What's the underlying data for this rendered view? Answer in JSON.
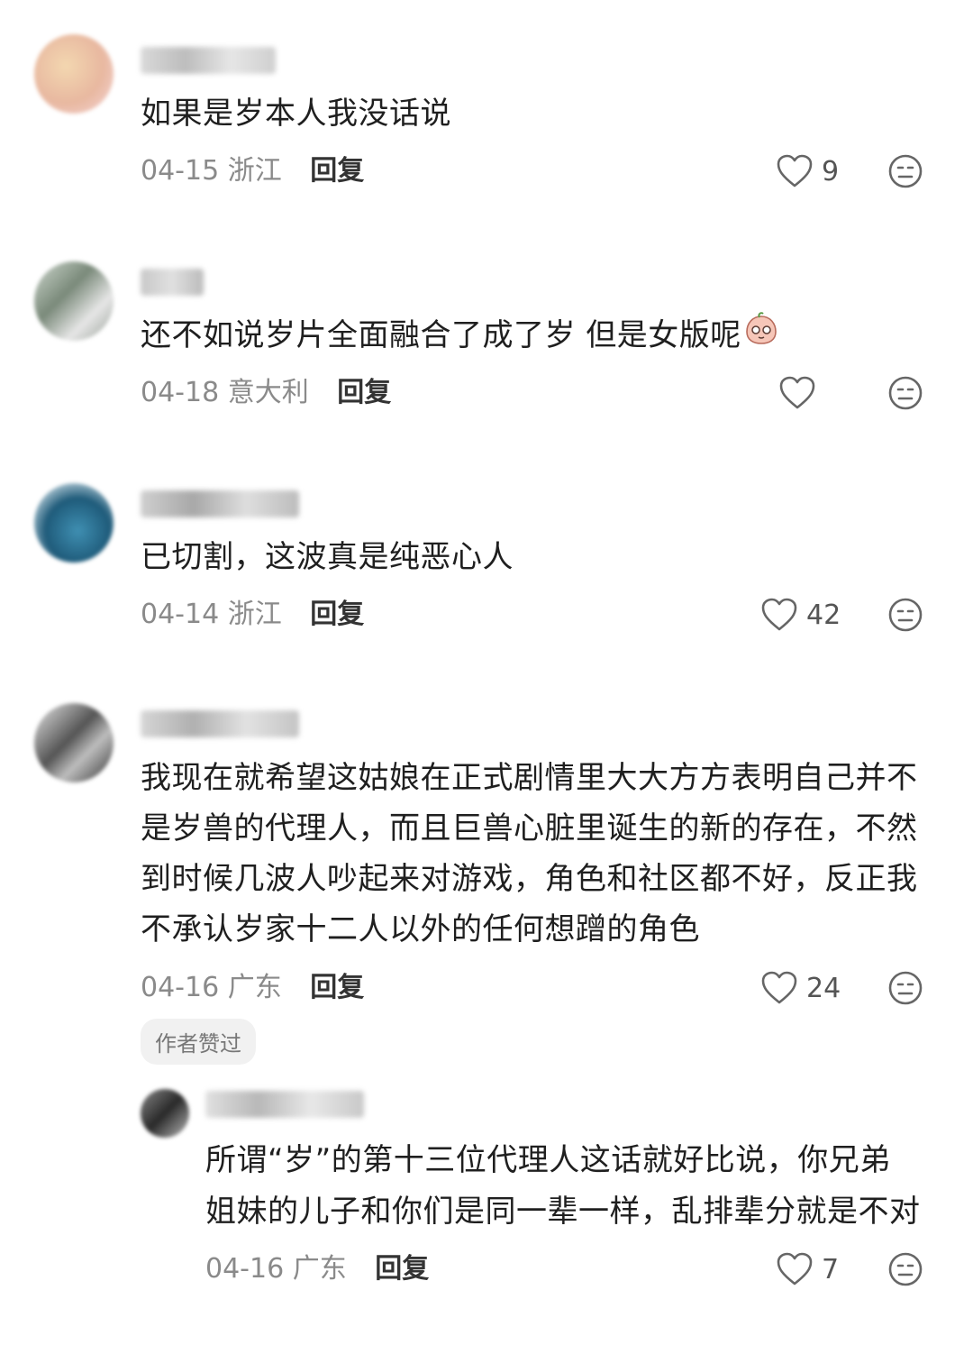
{
  "comments": [
    {
      "text": "如果是岁本人我没话说",
      "date": "04-15",
      "location": "浙江",
      "reply_label": "回复",
      "likes": "9"
    },
    {
      "text": "还不如说岁片全面融合了成了岁 但是女版呢",
      "date": "04-18",
      "location": "意大利",
      "reply_label": "回复",
      "likes": ""
    },
    {
      "text": "已切割，这波真是纯恶心人",
      "date": "04-14",
      "location": "浙江",
      "reply_label": "回复",
      "likes": "42"
    },
    {
      "lines": [
        "我现在就希望这姑娘在正式剧情里大大方方表明自己并不",
        "是岁兽的代理人，而且巨兽心脏里诞生的新的存在，不然",
        "到时候几波人吵起来对游戏，角色和社区都不好，反正我",
        "不承认岁家十二人以外的任何想蹭的角色"
      ],
      "date": "04-16",
      "location": "广东",
      "reply_label": "回复",
      "likes": "24",
      "badge": "作者赞过"
    }
  ],
  "reply": {
    "lines": [
      "所谓“岁”的第十三位代理人这话就好比说，你兄弟",
      "姐妹的儿子和你们是同一辈一样，乱排辈分就是不对"
    ],
    "date": "04-16",
    "location": "广东",
    "reply_label": "回复",
    "likes": "7"
  },
  "icons": {
    "like": "heart-outline-icon",
    "dislike": "neutral-face-icon",
    "inline_emoji": "peach-face-emoji"
  }
}
